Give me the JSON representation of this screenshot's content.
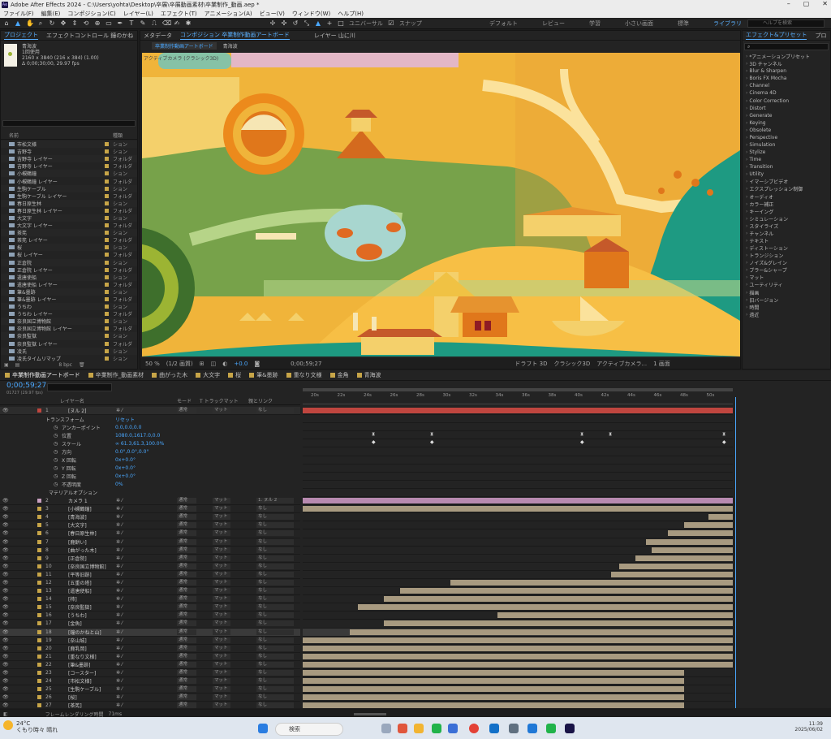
{
  "title": "Adobe After Effects 2024 - C:\\Users\\yohta\\Desktop\\卒展\\卒展動画素材\\卒業制作_動画.aep *",
  "menu": [
    "ファイル(F)",
    "編集(E)",
    "コンポジション(C)",
    "レイヤー(L)",
    "エフェクト(T)",
    "アニメーション(A)",
    "ビュー(V)",
    "ウィンドウ(W)",
    "ヘルプ(H)"
  ],
  "toolbar": {
    "universal": "ユニバーサル",
    "snap": "スナップ"
  },
  "workspaces": [
    "デフォルト",
    "レビュー",
    "学習",
    "小さい画面",
    "標準",
    "ライブラリ"
  ],
  "help_search": "ヘルプを検索",
  "project": {
    "tab": "プロジェクト",
    "tab2": "エフェクトコントロール 鐘のかね",
    "item_name": "青海波",
    "item_uses": "1回使用",
    "item_size": "2160 x 3840 (216 x 384) (1.00)",
    "item_time": "Δ 0;00;30;00, 29.97 fps",
    "col_name": "名前",
    "col_type": "種類",
    "items": [
      {
        "n": "市松文様",
        "k": "ション"
      },
      {
        "n": "吉野寺",
        "k": "ション"
      },
      {
        "n": "吉野寺 レイヤー",
        "k": "フォルダ"
      },
      {
        "n": "吉野寺 レイヤー",
        "k": "フォルダ"
      },
      {
        "n": "小槻鶴鐘",
        "k": "ション"
      },
      {
        "n": "小槻鶴鐘 レイヤー",
        "k": "フォルダ"
      },
      {
        "n": "生駒ケーブル",
        "k": "ション"
      },
      {
        "n": "生駒ケーブル レイヤー",
        "k": "フォルダ"
      },
      {
        "n": "春日原生林",
        "k": "ション"
      },
      {
        "n": "春日原生林 レイヤー",
        "k": "フォルダ"
      },
      {
        "n": "大文字",
        "k": "ション"
      },
      {
        "n": "大文字 レイヤー",
        "k": "フォルダ"
      },
      {
        "n": "茶筅",
        "k": "ション"
      },
      {
        "n": "茶筅 レイヤー",
        "k": "フォルダ"
      },
      {
        "n": "桜",
        "k": "ション"
      },
      {
        "n": "桜 レイヤー",
        "k": "フォルダ"
      },
      {
        "n": "正倉院",
        "k": "ション"
      },
      {
        "n": "正倉院 レイヤー",
        "k": "フォルダ"
      },
      {
        "n": "遣唐使船",
        "k": "ション"
      },
      {
        "n": "遣唐使船 レイヤー",
        "k": "フォルダ"
      },
      {
        "n": "筆&墨跡",
        "k": "ション"
      },
      {
        "n": "筆&墨跡 レイヤー",
        "k": "フォルダ"
      },
      {
        "n": "うちわ",
        "k": "ション"
      },
      {
        "n": "うちわ レイヤー",
        "k": "フォルダ"
      },
      {
        "n": "奈良国立博物館",
        "k": "ション"
      },
      {
        "n": "奈良国立博物館 レイヤー",
        "k": "フォルダ"
      },
      {
        "n": "奈良監獄",
        "k": "ション"
      },
      {
        "n": "奈良監獄 レイヤー",
        "k": "フォルダ"
      },
      {
        "n": "凌氏",
        "k": "ション"
      },
      {
        "n": "凌氏タイムリマップ",
        "k": "ション"
      }
    ],
    "bpc": "8 bpc"
  },
  "comp": {
    "tab_meta": "メタデータ",
    "tab_comp": "コンポジション 卒業制作動画アートボード",
    "tab_layer": "レイヤー 山に川",
    "sub_tab1": "卒業制作動画アートボード",
    "sub_tab2": "青海波",
    "active_camera_label": "アクティブカメラ (クラシック3D)",
    "zoom": "50 %",
    "quality": "(1/2 画質)",
    "exposure": "+0.0",
    "timecode": "0;00;59;27",
    "draft": "ドラフト 3D",
    "renderer": "クラシック3D",
    "camera": "アクティブカメラ...",
    "views": "1 画面"
  },
  "effects": {
    "tab": "エフェクト&プリセット",
    "tab2": "プロ",
    "items": [
      "*アニメーションプリセット",
      "3D チャンネル",
      "Blur & Sharpen",
      "Boris FX Mocha",
      "Channel",
      "Cinema 4D",
      "Color Correction",
      "Distort",
      "Generate",
      "Keying",
      "Obsolete",
      "Perspective",
      "Simulation",
      "Stylize",
      "Time",
      "Transition",
      "Utility",
      "イマーシブビデオ",
      "エクスプレッション制御",
      "オーディオ",
      "カラー補正",
      "キーイング",
      "シミュレーション",
      "スタイライズ",
      "チャンネル",
      "テキスト",
      "ディストーション",
      "トランジション",
      "ノイズ&グレイン",
      "ブラー&シャープ",
      "マット",
      "ユーティリティ",
      "描画",
      "旧バージョン",
      "時間",
      "遠近"
    ]
  },
  "timeline": {
    "tabs": [
      "卒業制作動画アートボード",
      "卒業制作_動画素材",
      "曲がった木",
      "大文字",
      "桜",
      "筆&墨跡",
      "重なり文様",
      "金角",
      "青海波"
    ],
    "timecode": "0;00;59;27",
    "fps": "01727 (29.97 fps)",
    "cols": {
      "layer": "レイヤー名",
      "mode": "モード",
      "trk": "T トラックマット",
      "parent": "親とリンク"
    },
    "ruler": [
      "20s",
      "22s",
      "24s",
      "26s",
      "28s",
      "30s",
      "32s",
      "34s",
      "36s",
      "38s",
      "40s",
      "42s",
      "44s",
      "46s",
      "48s",
      "50s"
    ],
    "null_layer": {
      "num": "1",
      "name": "[ヌル 2]",
      "mode": "通常",
      "parent": "なし"
    },
    "transform_label": "トランスフォーム",
    "reset": "リセット",
    "props": [
      {
        "n": "アンカーポイント",
        "v": "0.0,0.0,0.0"
      },
      {
        "n": "位置",
        "v": "1080.0,1617.0,0.0"
      },
      {
        "n": "スケール",
        "v": "∞ 61.3,61.3,100.0%"
      },
      {
        "n": "方向",
        "v": "0.0°,0.0°,0.0°"
      },
      {
        "n": "X 回転",
        "v": "0x+0.0°"
      },
      {
        "n": "Y 回転",
        "v": "0x+0.0°"
      },
      {
        "n": "Z 回転",
        "v": "0x+0.0°"
      },
      {
        "n": "不透明度",
        "v": "0%"
      }
    ],
    "material": "マテリアルオプション",
    "camera_layer": {
      "num": "2",
      "name": "カメラ 1",
      "parent": "1. ヌル 2"
    },
    "layers": [
      {
        "num": "3",
        "name": "[小槻鶴鐘]"
      },
      {
        "num": "4",
        "name": "[青海波]"
      },
      {
        "num": "5",
        "name": "[大文字]"
      },
      {
        "num": "6",
        "name": "[春日原生林]"
      },
      {
        "num": "7",
        "name": "[鹿餅い]"
      },
      {
        "num": "8",
        "name": "[曲がった木]"
      },
      {
        "num": "9",
        "name": "[正倉院]"
      },
      {
        "num": "10",
        "name": "[奈良国立博物館]"
      },
      {
        "num": "11",
        "name": "[平等旧跡]"
      },
      {
        "num": "12",
        "name": "[五重の塔]"
      },
      {
        "num": "13",
        "name": "[遣唐使船]"
      },
      {
        "num": "14",
        "name": "[柿]"
      },
      {
        "num": "15",
        "name": "[奈良監獄]"
      },
      {
        "num": "16",
        "name": "[うちわ]"
      },
      {
        "num": "17",
        "name": "[金魚]"
      },
      {
        "num": "18",
        "name": "[鐘のかねと山]"
      },
      {
        "num": "19",
        "name": "[奈山城]"
      },
      {
        "num": "20",
        "name": "[鹿乳岡]"
      },
      {
        "num": "21",
        "name": "[重なり文様]"
      },
      {
        "num": "22",
        "name": "[筆&墨跡]"
      },
      {
        "num": "23",
        "name": "[コースター]"
      },
      {
        "num": "24",
        "name": "[市松文様]"
      },
      {
        "num": "25",
        "name": "[生駒ケーブル]"
      },
      {
        "num": "26",
        "name": "[桜]"
      },
      {
        "num": "27",
        "name": "[茶筅]"
      }
    ],
    "layer_mode": "通常",
    "layer_trk": "マット",
    "layer_parent": "なし",
    "frame_time_label": "フレームレンダリング時間",
    "frame_time": "71ms"
  },
  "taskbar": {
    "temp": "24°C",
    "weather": "くもり時々 晴れ",
    "search": "検索",
    "time": "11:39",
    "date": "2025/06/02"
  },
  "colors": {
    "accent": "#4aa8ff",
    "bar_tan": "#a89a80",
    "bar_red": "#c0463f",
    "bar_camera": "#b88ab0"
  }
}
